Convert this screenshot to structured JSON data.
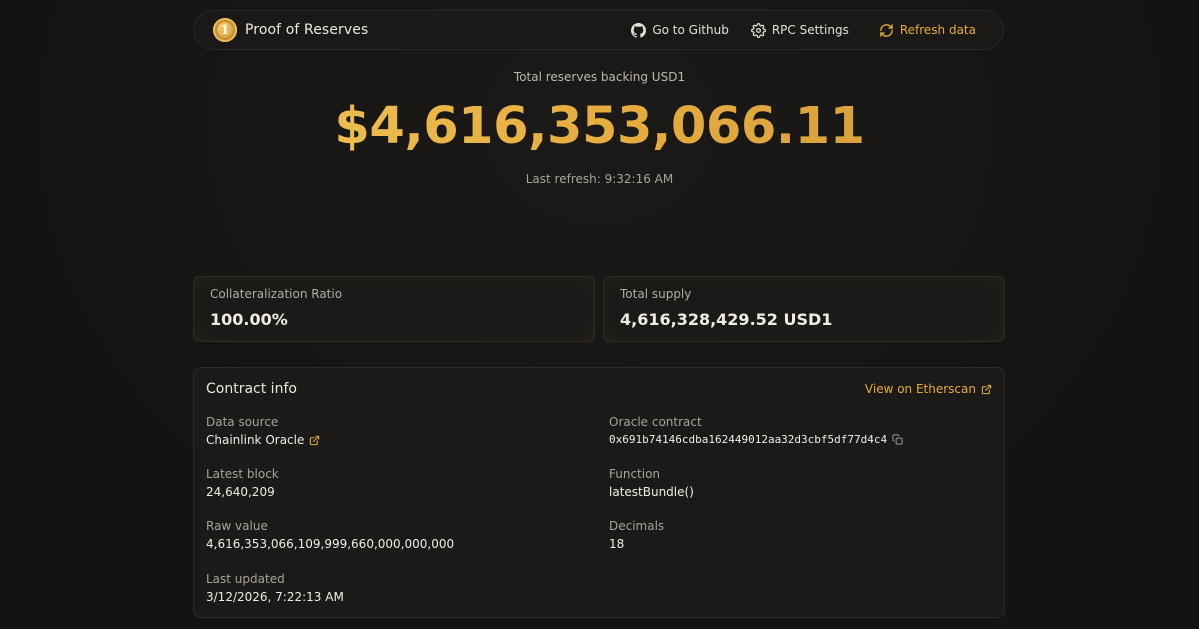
{
  "navbar": {
    "brand_coin_glyph": "1",
    "brand_name": "Proof of Reserves",
    "github_label": "Go to Github",
    "rpc_label": "RPC Settings",
    "refresh_label": "Refresh data",
    "accent_color": "#e3ab3c"
  },
  "hero": {
    "caption": "Total reserves backing USD1",
    "amount": "$4,616,353,066.11",
    "last_refresh": "Last refresh: 9:32:16 AM"
  },
  "stats": {
    "collateralization_label": "Collateralization Ratio",
    "collateralization_value": "100.00%",
    "supply_label": "Total supply",
    "supply_value": "4,616,328,429.52 USD1"
  },
  "contract": {
    "title": "Contract info",
    "etherscan_label": "View on Etherscan",
    "fields": {
      "data_source": {
        "label": "Data source",
        "value": "Chainlink Oracle"
      },
      "oracle_contract": {
        "label": "Oracle contract",
        "value": "0x691b74146cdba162449012aa32d3cbf5df77d4c4"
      },
      "latest_block": {
        "label": "Latest block",
        "value": "24,640,209"
      },
      "function": {
        "label": "Function",
        "value": "latestBundle()"
      },
      "raw_value": {
        "label": "Raw value",
        "value": "4,616,353,066,109,999,660,000,000,000"
      },
      "decimals": {
        "label": "Decimals",
        "value": "18"
      },
      "last_updated": {
        "label": "Last updated",
        "value": "3/12/2026, 7:22:13 AM"
      }
    }
  },
  "icons": {
    "github": "github-icon",
    "rpc": "gear-icon",
    "refresh": "refresh-icon",
    "external": "external-link-icon",
    "copy": "copy-icon"
  }
}
